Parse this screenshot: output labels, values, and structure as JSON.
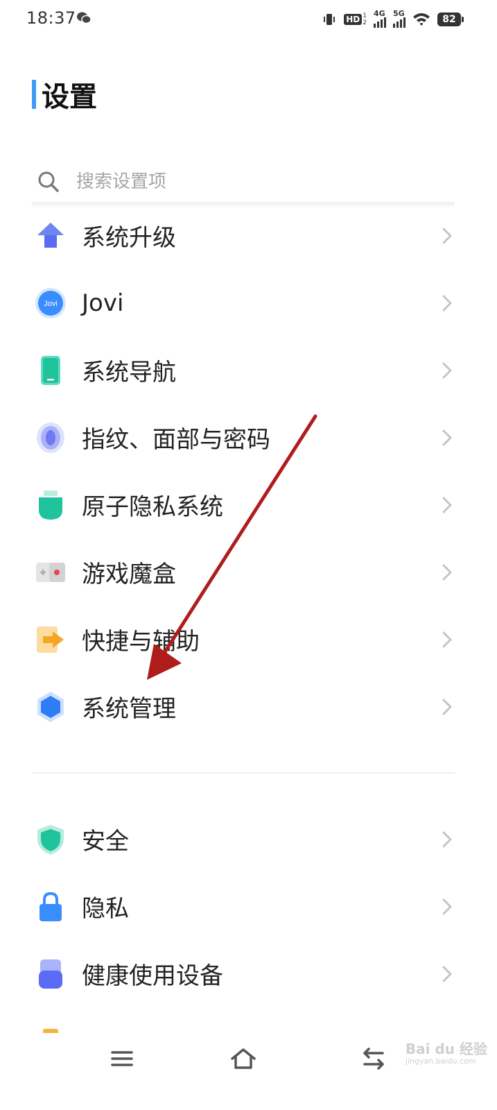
{
  "status_bar": {
    "time": "18:37",
    "hd_label": "HD",
    "hd_sim1": "1",
    "hd_sim2": "2",
    "network1": "4G",
    "network2": "5G",
    "battery": "82",
    "icons": [
      "wechat-icon",
      "vibrate-icon",
      "wifi-icon",
      "battery-icon"
    ]
  },
  "page": {
    "title": "设置",
    "accent_color": "#3d9cf5"
  },
  "search": {
    "placeholder": "搜索设置项"
  },
  "settings": {
    "items": [
      {
        "label": "系统升级",
        "icon": "arrow-up-icon",
        "color": "#5a7df0"
      },
      {
        "label": "Jovi",
        "icon": "jovi-icon",
        "color": "#3a8dff",
        "icon_text": "Jovi"
      },
      {
        "label": "系统导航",
        "icon": "phone-icon",
        "color": "#2bc9a4"
      },
      {
        "label": "指纹、面部与密码",
        "icon": "fingerprint-icon",
        "color": "#6f79f0"
      },
      {
        "label": "原子隐私系统",
        "icon": "privacy-system-icon",
        "color": "#2bc9a4"
      },
      {
        "label": "游戏魔盒",
        "icon": "game-box-icon",
        "color": "#e8444f"
      },
      {
        "label": "快捷与辅助",
        "icon": "shortcut-icon",
        "color": "#f5a623"
      },
      {
        "label": "系统管理",
        "icon": "hexagon-icon",
        "color": "#2f7df6"
      },
      {
        "label": "安全",
        "icon": "shield-icon",
        "color": "#2bc9a4"
      },
      {
        "label": "隐私",
        "icon": "lock-icon",
        "color": "#3a8dff"
      },
      {
        "label": "健康使用设备",
        "icon": "health-usage-icon",
        "color": "#5a6cf5"
      }
    ]
  },
  "nav_bar": {
    "icons": [
      "menu-icon",
      "home-icon",
      "back-icon"
    ]
  },
  "watermark": {
    "brand": "Bai du 经验",
    "url": "jingyan.baidu.com"
  },
  "annotation": {
    "arrow_color": "#b01c1c",
    "points_to": "系统管理"
  }
}
